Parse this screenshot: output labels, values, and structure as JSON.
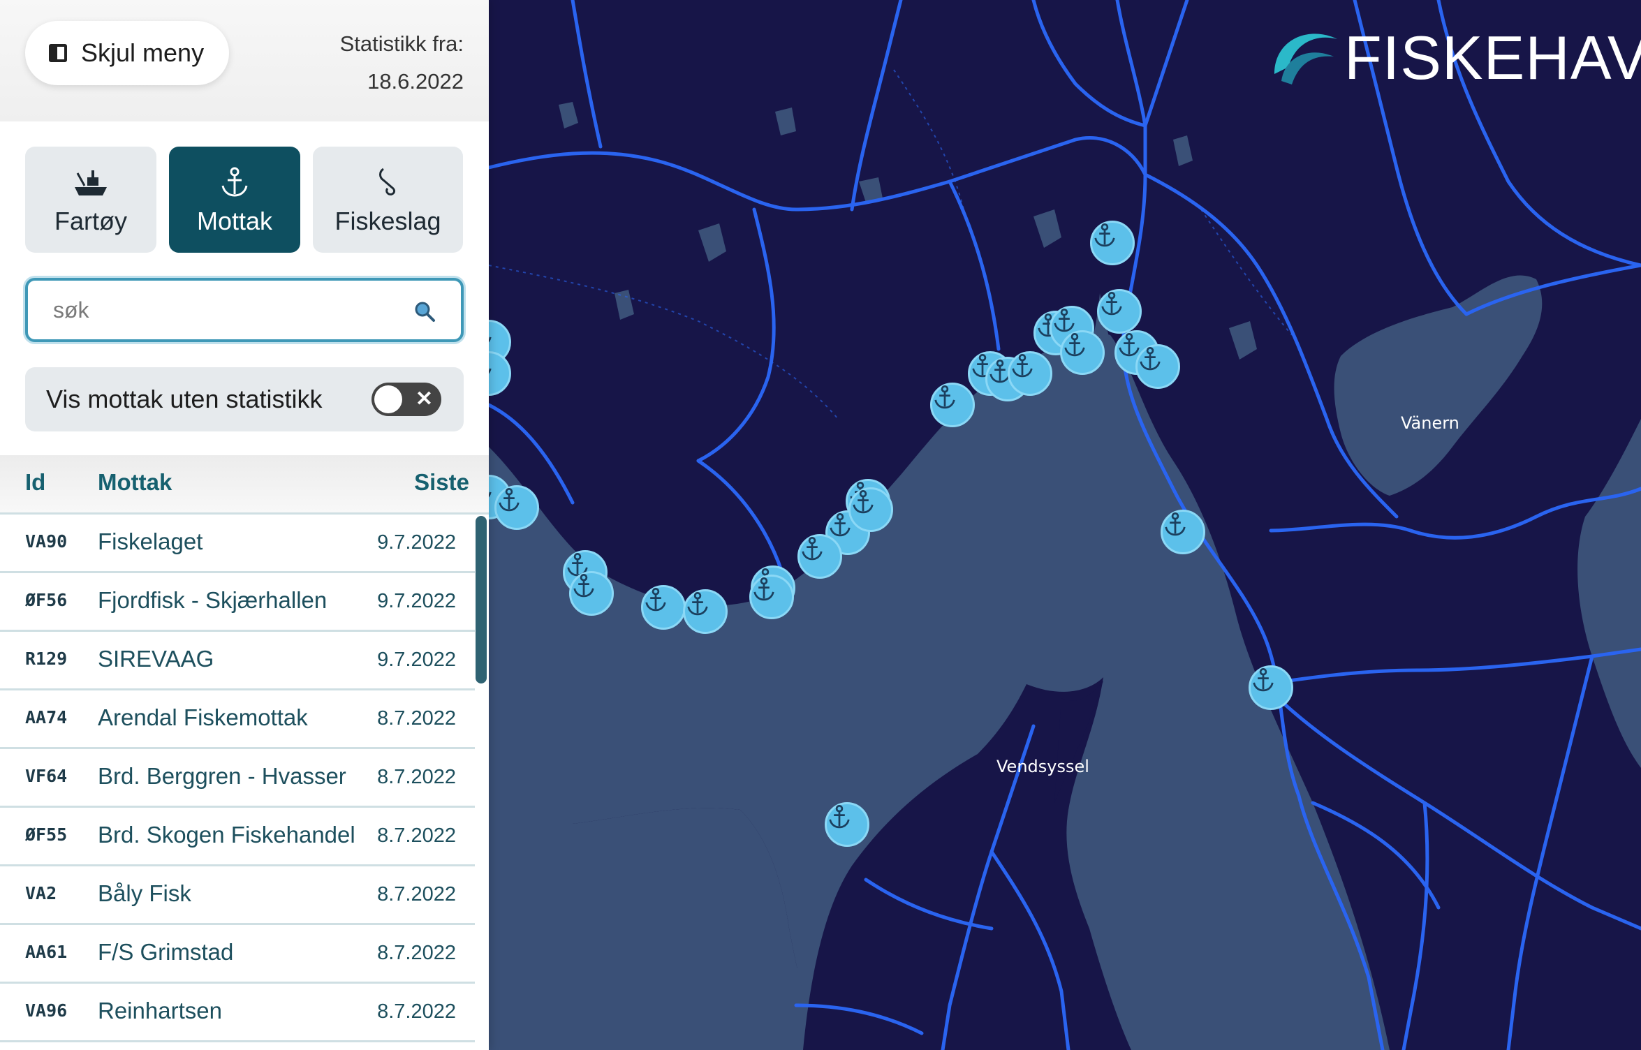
{
  "sidebar": {
    "hide_button": "Skjul meny",
    "stat_label": "Statistikk fra:",
    "stat_date": "18.6.2022",
    "tabs": [
      {
        "label": "Fartøy",
        "icon": "boat-icon",
        "active": false
      },
      {
        "label": "Mottak",
        "icon": "anchor-icon",
        "active": true
      },
      {
        "label": "Fiskeslag",
        "icon": "hook-icon",
        "active": false
      }
    ],
    "search": {
      "placeholder": "søk",
      "value": ""
    },
    "toggle": {
      "label": "Vis mottak uten statistikk",
      "on": false
    },
    "table": {
      "headers": {
        "id": "Id",
        "name": "Mottak",
        "last": "Siste"
      },
      "rows": [
        {
          "id": "VA90",
          "name": "Fiskelaget",
          "date": "9.7.2022"
        },
        {
          "id": "ØF56",
          "name": "Fjordfisk - Skjærhallen",
          "date": "9.7.2022"
        },
        {
          "id": "R129",
          "name": "SIREVAAG",
          "date": "9.7.2022"
        },
        {
          "id": "AA74",
          "name": "Arendal Fiskemottak",
          "date": "8.7.2022"
        },
        {
          "id": "VF64",
          "name": "Brd. Berggren - Hvasser",
          "date": "8.7.2022"
        },
        {
          "id": "ØF55",
          "name": "Brd. Skogen Fiskehandel",
          "date": "8.7.2022"
        },
        {
          "id": "VA2",
          "name": "Båly Fisk",
          "date": "8.7.2022"
        },
        {
          "id": "AA61",
          "name": "F/S Grimstad",
          "date": "8.7.2022"
        },
        {
          "id": "VA96",
          "name": "Reinhartsen",
          "date": "8.7.2022"
        }
      ]
    }
  },
  "brand": {
    "name": "FISKEHAV"
  },
  "map": {
    "places": {
      "vanern": "Vänern",
      "vendsyssel": "Vendsyssel"
    },
    "colors": {
      "land": "#171548",
      "sea": "#3a5077",
      "roads": "#2a64f0",
      "marker": "#5cc0ea",
      "accent": "#0e4f60"
    }
  }
}
